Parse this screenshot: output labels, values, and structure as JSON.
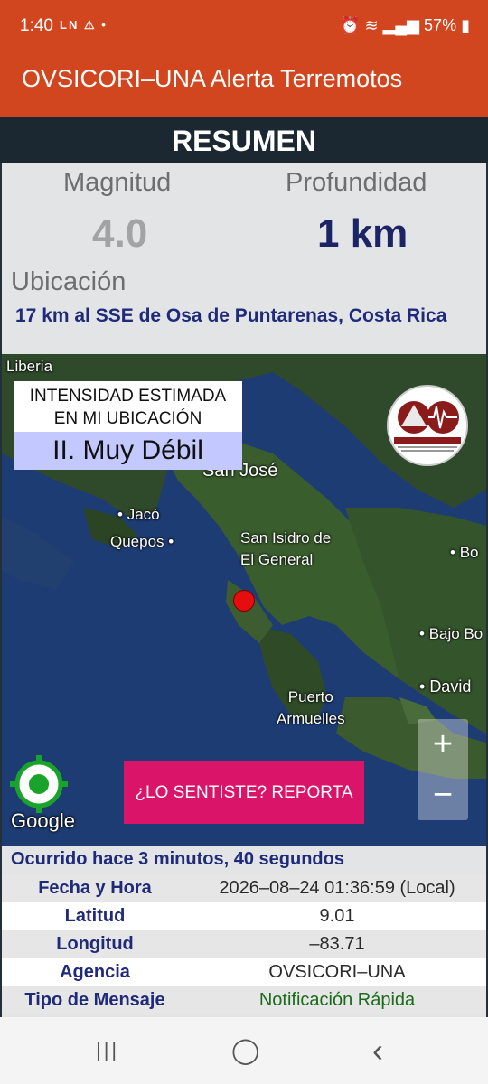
{
  "status_bar": {
    "time": "1:40",
    "left_icons": "LN ⚠ •",
    "battery": "57%"
  },
  "app": {
    "title": "OVSICORI–UNA Alerta Terremotos"
  },
  "summary": {
    "header": "RESUMEN",
    "magnitude_label": "Magnitud",
    "magnitude_value": "4.0",
    "depth_label": "Profundidad",
    "depth_value": "1 km",
    "location_label": "Ubicación",
    "location_value": "17 km al SSE de Osa de Puntarenas, Costa Rica"
  },
  "map": {
    "intensity_title_1": "INTENSIDAD ESTIMADA",
    "intensity_title_2": "EN MI UBICACIÓN",
    "intensity_value": "II. Muy Débil",
    "places": {
      "liberia": "Liberia",
      "san_jose": "San José",
      "jaco": "Jacó",
      "quepos": "Quepos",
      "san_isidro": "San Isidro de\nEl General",
      "boca": "Bo",
      "bajo_boquete": "Bajo Bo",
      "david": "David",
      "puerto_armuelles": "Puerto\nArmuelles"
    },
    "zoom_in": "+",
    "zoom_out": "−",
    "google_label": "Google",
    "report_button": "¿LO SENTISTE? REPORTA",
    "colors": {
      "marker": "#e50d0d",
      "report_button": "#d91469"
    }
  },
  "details": {
    "occurred": "Ocurrido hace 3 minutos, 40 segundos",
    "rows": [
      {
        "key": "Fecha y Hora",
        "value": "2026–08–24 01:36:59 (Local)"
      },
      {
        "key": "Latitud",
        "value": "9.01"
      },
      {
        "key": "Longitud",
        "value": "–83.71"
      },
      {
        "key": "Agencia",
        "value": "OVSICORI–UNA"
      },
      {
        "key": "Tipo de Mensaje",
        "value": "Notificación Rápida"
      }
    ]
  },
  "nav": {
    "recents": "|||",
    "home": "◯",
    "back": "‹"
  }
}
